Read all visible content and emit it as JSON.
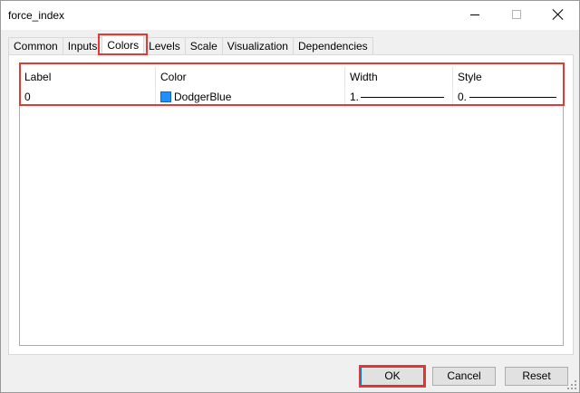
{
  "window": {
    "title": "force_index",
    "min_icon": "minimize-icon",
    "max_icon": "maximize-icon",
    "close_icon": "close-icon"
  },
  "tabs": [
    {
      "label": "Common",
      "active": false
    },
    {
      "label": "Inputs",
      "active": false
    },
    {
      "label": "Colors",
      "active": true
    },
    {
      "label": "Levels",
      "active": false
    },
    {
      "label": "Scale",
      "active": false
    },
    {
      "label": "Visualization",
      "active": false
    },
    {
      "label": "Dependencies",
      "active": false
    }
  ],
  "colors_table": {
    "headers": {
      "label": "Label",
      "color": "Color",
      "width": "Width",
      "style": "Style"
    },
    "rows": [
      {
        "label": "0",
        "color_name": "DodgerBlue",
        "color_hex": "#1e90ff",
        "width": "1.",
        "style": "0."
      }
    ]
  },
  "buttons": {
    "ok": "OK",
    "cancel": "Cancel",
    "reset": "Reset"
  },
  "highlight_color": "#e53935"
}
